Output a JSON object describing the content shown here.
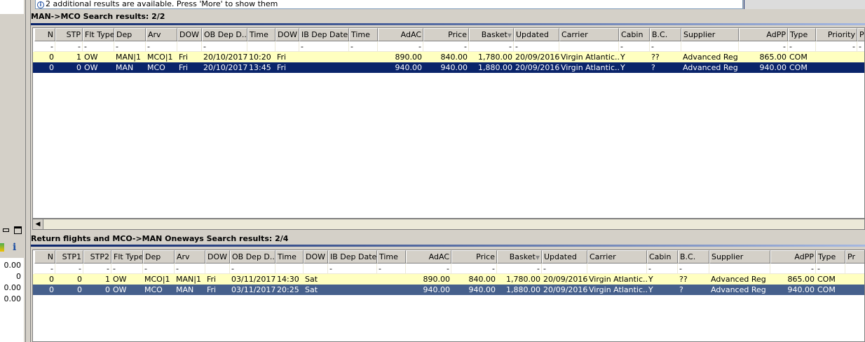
{
  "info_message": "2 additional results are available. Press 'More' to show them",
  "left_panel": {
    "values": [
      "0.00",
      "0",
      "0.00",
      "0.00"
    ],
    "info_icon": "i"
  },
  "outbound": {
    "title": "MAN->MCO Search results: 2/2",
    "columns": [
      "N",
      "STP",
      "Flt Type",
      "Dep",
      "Arv",
      "DOW",
      "OB Dep D...",
      "Time",
      "DOW",
      "IB Dep Date",
      "Time",
      "AdAC",
      "Price",
      "Basket",
      "Updated",
      "Carrier",
      "Cabin",
      "B.C.",
      "Supplier",
      "AdPP",
      "Type",
      "Priority",
      "Pr"
    ],
    "filter_row": [
      "-",
      "-",
      "-",
      "-",
      "-",
      "",
      "-",
      "",
      "",
      "-",
      "-",
      "-",
      "-",
      "-",
      "-",
      "",
      "-",
      "-",
      "",
      "-",
      "-",
      "-",
      "-"
    ],
    "rows": [
      [
        "0",
        "1",
        "OW",
        "MAN|1",
        "MCO|1",
        "Fri",
        "20/10/2017",
        "10:20",
        "Fri",
        "",
        "",
        "890.00",
        "840.00",
        "1,780.00",
        "20/09/2016",
        "Virgin Atlantic...",
        "Y",
        "??",
        "Advanced Reg",
        "865.00",
        "COM",
        "",
        ""
      ],
      [
        "0",
        "0",
        "OW",
        "MAN",
        "MCO",
        "Fri",
        "20/10/2017",
        "13:45",
        "Fri",
        "",
        "",
        "940.00",
        "940.00",
        "1,880.00",
        "20/09/2016",
        "Virgin Atlantic...",
        "Y",
        "?",
        "Advanced Reg",
        "940.00",
        "COM",
        "",
        ""
      ]
    ]
  },
  "return": {
    "title": "Return flights and MCO->MAN Oneways Search results: 2/4",
    "columns": [
      "N",
      "STP1",
      "STP2",
      "Flt Type",
      "Dep",
      "Arv",
      "DOW",
      "OB Dep D...",
      "Time",
      "DOW",
      "IB Dep Date",
      "Time",
      "AdAC",
      "Price",
      "Basket",
      "Updated",
      "Carrier",
      "Cabin",
      "B.C.",
      "Supplier",
      "AdPP",
      "Type",
      "Pr"
    ],
    "filter_row": [
      "-",
      "-",
      "-",
      "-",
      "-",
      "-",
      "",
      "-",
      "",
      "",
      "-",
      "-",
      "-",
      "-",
      "-",
      "-",
      "",
      "-",
      "-",
      "",
      "-",
      "-",
      ""
    ],
    "rows": [
      [
        "0",
        "0",
        "1",
        "OW",
        "MCO|1",
        "MAN|1",
        "Fri",
        "03/11/2017",
        "14:30",
        "Sat",
        "",
        "",
        "890.00",
        "840.00",
        "1,780.00",
        "20/09/2016",
        "Virgin Atlantic...",
        "Y",
        "??",
        "Advanced Reg",
        "865.00",
        "COM",
        ""
      ],
      [
        "0",
        "0",
        "0",
        "OW",
        "MCO",
        "MAN",
        "Fri",
        "03/11/2017",
        "20:25",
        "Sat",
        "",
        "",
        "940.00",
        "940.00",
        "1,880.00",
        "20/09/2016",
        "Virgin Atlantic...",
        "Y",
        "?",
        "Advanced Reg",
        "940.00",
        "COM",
        ""
      ]
    ]
  }
}
